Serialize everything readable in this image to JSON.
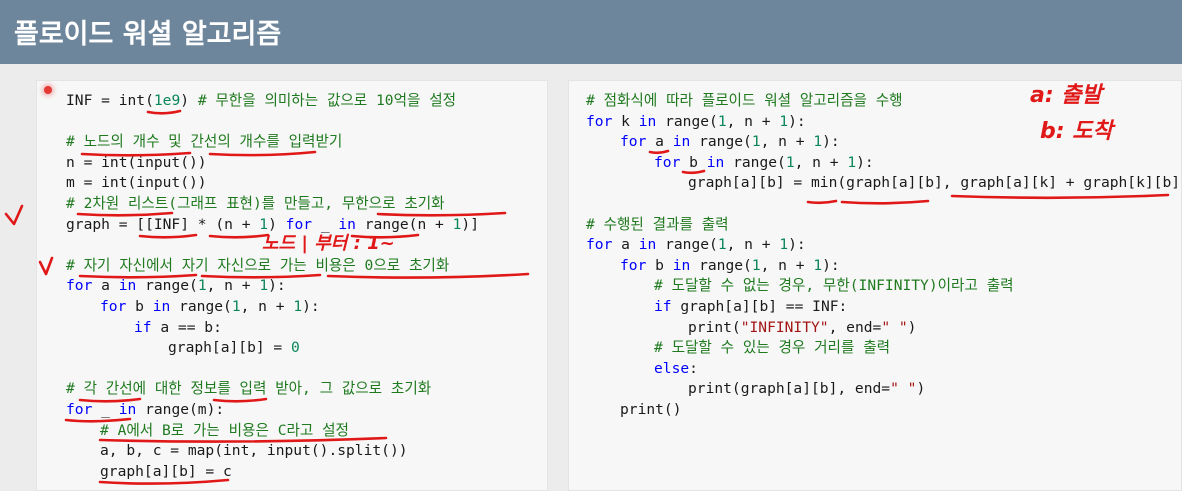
{
  "header": {
    "title": "플로이드 워셜 알고리즘"
  },
  "colors": {
    "keyword": "#0000ff",
    "comment": "#1f7a1f",
    "number": "#098658",
    "string": "#a31515",
    "text": "#1a1a1a",
    "annotation": "#e01818"
  },
  "left_code": [
    {
      "indent": 0,
      "tokens": [
        [
          "t",
          "INF = int("
        ],
        [
          "n",
          "1e9"
        ],
        [
          "t",
          ") "
        ],
        [
          "c",
          "# 무한을 의미하는 값으로 10억을 설정"
        ]
      ]
    },
    {
      "indent": 0,
      "tokens": []
    },
    {
      "indent": 0,
      "tokens": [
        [
          "c",
          "# 노드의 개수 및 간선의 개수를 입력받기"
        ]
      ]
    },
    {
      "indent": 0,
      "tokens": [
        [
          "t",
          "n = int(input())"
        ]
      ]
    },
    {
      "indent": 0,
      "tokens": [
        [
          "t",
          "m = int(input())"
        ]
      ]
    },
    {
      "indent": 0,
      "tokens": [
        [
          "c",
          "# 2차원 리스트(그래프 표현)를 만들고, 무한으로 초기화"
        ]
      ]
    },
    {
      "indent": 0,
      "tokens": [
        [
          "t",
          "graph = [[INF] * (n + "
        ],
        [
          "n",
          "1"
        ],
        [
          "t",
          ") "
        ],
        [
          "k",
          "for"
        ],
        [
          "t",
          " _ "
        ],
        [
          "k",
          "in"
        ],
        [
          "t",
          " range(n + "
        ],
        [
          "n",
          "1"
        ],
        [
          "t",
          ")]"
        ]
      ]
    },
    {
      "indent": 0,
      "tokens": []
    },
    {
      "indent": 0,
      "tokens": [
        [
          "c",
          "# 자기 자신에서 자기 자신으로 가는 비용은 0으로 초기화"
        ]
      ]
    },
    {
      "indent": 0,
      "tokens": [
        [
          "k",
          "for"
        ],
        [
          "t",
          " a "
        ],
        [
          "k",
          "in"
        ],
        [
          "t",
          " range("
        ],
        [
          "n",
          "1"
        ],
        [
          "t",
          ", n + "
        ],
        [
          "n",
          "1"
        ],
        [
          "t",
          "):"
        ]
      ]
    },
    {
      "indent": 1,
      "tokens": [
        [
          "k",
          "for"
        ],
        [
          "t",
          " b "
        ],
        [
          "k",
          "in"
        ],
        [
          "t",
          " range("
        ],
        [
          "n",
          "1"
        ],
        [
          "t",
          ", n + "
        ],
        [
          "n",
          "1"
        ],
        [
          "t",
          "):"
        ]
      ]
    },
    {
      "indent": 2,
      "tokens": [
        [
          "k",
          "if"
        ],
        [
          "t",
          " a == b:"
        ]
      ]
    },
    {
      "indent": 3,
      "tokens": [
        [
          "t",
          "graph[a][b] = "
        ],
        [
          "n",
          "0"
        ]
      ]
    },
    {
      "indent": 0,
      "tokens": []
    },
    {
      "indent": 0,
      "tokens": [
        [
          "c",
          "# 각 간선에 대한 정보를 입력 받아, 그 값으로 초기화"
        ]
      ]
    },
    {
      "indent": 0,
      "tokens": [
        [
          "k",
          "for"
        ],
        [
          "t",
          " _ "
        ],
        [
          "k",
          "in"
        ],
        [
          "t",
          " range(m):"
        ]
      ]
    },
    {
      "indent": 1,
      "tokens": [
        [
          "c",
          "# A에서 B로 가는 비용은 C라고 설정"
        ]
      ]
    },
    {
      "indent": 1,
      "tokens": [
        [
          "t",
          "a, b, c = map(int, input().split())"
        ]
      ]
    },
    {
      "indent": 1,
      "tokens": [
        [
          "t",
          "graph[a][b] = c"
        ]
      ]
    }
  ],
  "right_code": [
    {
      "indent": 0,
      "tokens": [
        [
          "c",
          "# 점화식에 따라 플로이드 워셜 알고리즘을 수행"
        ]
      ]
    },
    {
      "indent": 0,
      "tokens": [
        [
          "k",
          "for"
        ],
        [
          "t",
          " k "
        ],
        [
          "k",
          "in"
        ],
        [
          "t",
          " range("
        ],
        [
          "n",
          "1"
        ],
        [
          "t",
          ", n + "
        ],
        [
          "n",
          "1"
        ],
        [
          "t",
          "):"
        ]
      ]
    },
    {
      "indent": 1,
      "tokens": [
        [
          "k",
          "for"
        ],
        [
          "t",
          " a "
        ],
        [
          "k",
          "in"
        ],
        [
          "t",
          " range("
        ],
        [
          "n",
          "1"
        ],
        [
          "t",
          ", n + "
        ],
        [
          "n",
          "1"
        ],
        [
          "t",
          "):"
        ]
      ]
    },
    {
      "indent": 2,
      "tokens": [
        [
          "k",
          "for"
        ],
        [
          "t",
          " b "
        ],
        [
          "k",
          "in"
        ],
        [
          "t",
          " range("
        ],
        [
          "n",
          "1"
        ],
        [
          "t",
          ", n + "
        ],
        [
          "n",
          "1"
        ],
        [
          "t",
          "):"
        ]
      ]
    },
    {
      "indent": 3,
      "tokens": [
        [
          "t",
          "graph[a][b] = min(graph[a][b], graph[a][k] + graph[k][b])"
        ]
      ]
    },
    {
      "indent": 0,
      "tokens": []
    },
    {
      "indent": 0,
      "tokens": [
        [
          "c",
          "# 수행된 결과를 출력"
        ]
      ]
    },
    {
      "indent": 0,
      "tokens": [
        [
          "k",
          "for"
        ],
        [
          "t",
          " a "
        ],
        [
          "k",
          "in"
        ],
        [
          "t",
          " range("
        ],
        [
          "n",
          "1"
        ],
        [
          "t",
          ", n + "
        ],
        [
          "n",
          "1"
        ],
        [
          "t",
          "):"
        ]
      ]
    },
    {
      "indent": 1,
      "tokens": [
        [
          "k",
          "for"
        ],
        [
          "t",
          " b "
        ],
        [
          "k",
          "in"
        ],
        [
          "t",
          " range("
        ],
        [
          "n",
          "1"
        ],
        [
          "t",
          ", n + "
        ],
        [
          "n",
          "1"
        ],
        [
          "t",
          "):"
        ]
      ]
    },
    {
      "indent": 2,
      "tokens": [
        [
          "c",
          "# 도달할 수 없는 경우, 무한(INFINITY)이라고 출력"
        ]
      ]
    },
    {
      "indent": 2,
      "tokens": [
        [
          "k",
          "if"
        ],
        [
          "t",
          " graph[a][b] == INF:"
        ]
      ]
    },
    {
      "indent": 3,
      "tokens": [
        [
          "t",
          "print("
        ],
        [
          "s",
          "\"INFINITY\""
        ],
        [
          "t",
          ", end="
        ],
        [
          "s",
          "\" \""
        ],
        [
          "t",
          ")"
        ]
      ]
    },
    {
      "indent": 2,
      "tokens": [
        [
          "c",
          "# 도달할 수 있는 경우 거리를 출력"
        ]
      ]
    },
    {
      "indent": 2,
      "tokens": [
        [
          "k",
          "else"
        ],
        [
          "t",
          ":"
        ]
      ]
    },
    {
      "indent": 3,
      "tokens": [
        [
          "t",
          "print(graph[a][b], end="
        ],
        [
          "s",
          "\" \""
        ],
        [
          "t",
          ")"
        ]
      ]
    },
    {
      "indent": 1,
      "tokens": [
        [
          "t",
          "print()"
        ]
      ]
    }
  ],
  "handwriting": {
    "note_a": "a: 출발",
    "note_b": "b: 도착",
    "note_node": "노드 | 부터 : 1~"
  }
}
